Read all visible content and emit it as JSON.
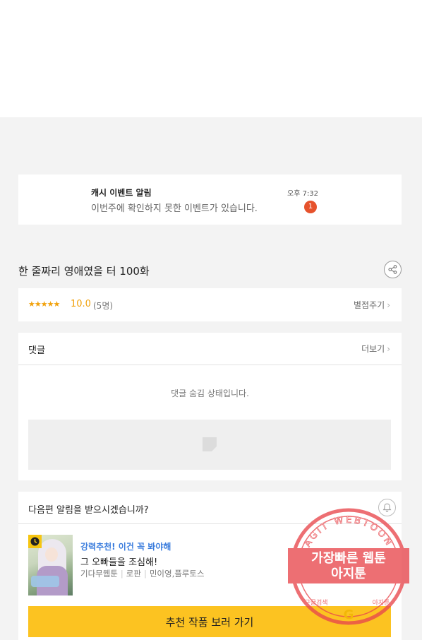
{
  "notification": {
    "title": "캐시 이벤트 알림",
    "body": "이번주에 확인하지 못한 이벤트가 있습니다.",
    "time": "오후 7:32",
    "badge": "1"
  },
  "episode": {
    "title": "한 줄짜리 영애였을 터 100화",
    "share_icon": "share-icon"
  },
  "rating": {
    "stars": "★★★★★",
    "score": "10.0",
    "count": "(5명)",
    "rate_label": "별점주기",
    "star_color": "#f1a10b"
  },
  "comments": {
    "title": "댓글",
    "more_label": "더보기",
    "hidden_message": "댓글 숨김 상태입니다."
  },
  "next_episode": {
    "question": "다음편 알림을 받으시겠습니까?",
    "bell_icon": "bell-icon"
  },
  "recommendation": {
    "tag": "강력추천! 이건 꼭 봐야해",
    "title": "그 오빠들을 조심해!",
    "meta": [
      "기다무웹툰",
      "로판",
      "민이영,플루토스"
    ],
    "cta_label": "추천 작품 보러 가기",
    "cta_color": "#fcc321",
    "tag_color": "#3b7ddd"
  },
  "watermark": {
    "top_text": "AGIT WEBTOON",
    "line1": "가장빠른 웹툰",
    "line2": "아지툰",
    "bottom_left": "구글검색",
    "bottom_right": "아지툰",
    "color": "#e8474d"
  }
}
